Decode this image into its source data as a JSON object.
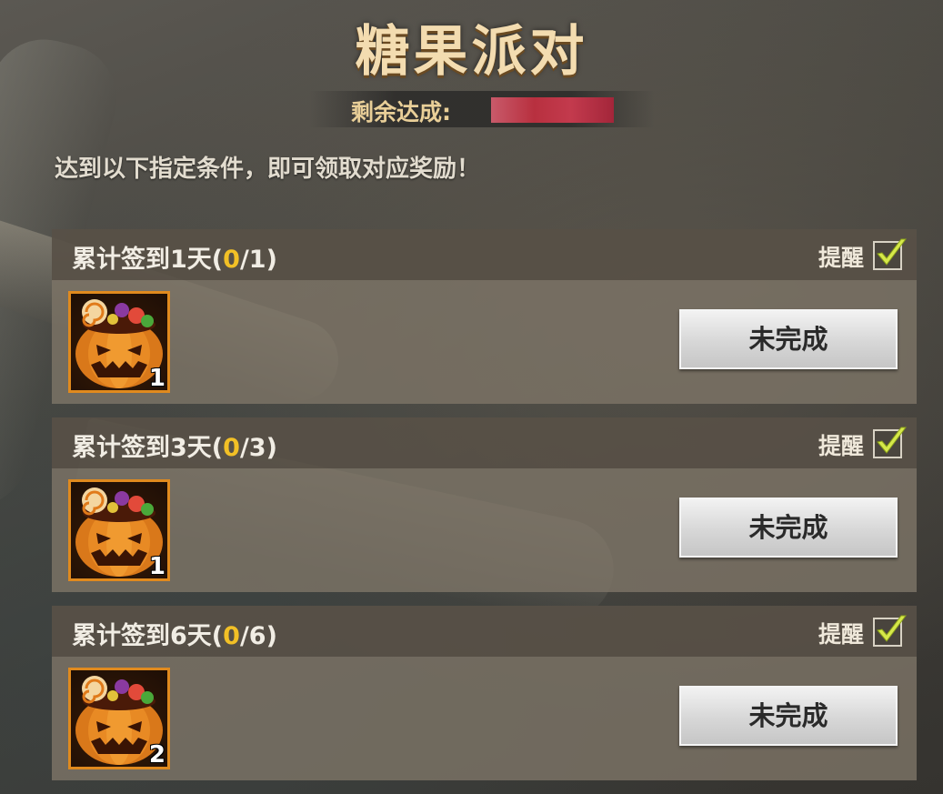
{
  "header": {
    "title": "糖果派对",
    "remain_label": "剩余达成:"
  },
  "intro_text": "达到以下指定条件，即可领取对应奖励！",
  "tasks": [
    {
      "title_prefix": "累计签到1天(",
      "progress_current": "0",
      "progress_rest": "/1)",
      "remind_label": "提醒",
      "remind_checked": true,
      "reward_icon": "candy-pumpkin-icon",
      "reward_count": "1",
      "status_label": "未完成"
    },
    {
      "title_prefix": "累计签到3天(",
      "progress_current": "0",
      "progress_rest": "/3)",
      "remind_label": "提醒",
      "remind_checked": true,
      "reward_icon": "candy-pumpkin-icon",
      "reward_count": "1",
      "status_label": "未完成"
    },
    {
      "title_prefix": "累计签到6天(",
      "progress_current": "0",
      "progress_rest": "/6)",
      "remind_label": "提醒",
      "remind_checked": true,
      "reward_icon": "candy-pumpkin-icon",
      "reward_count": "2",
      "status_label": "未完成"
    }
  ],
  "colors": {
    "title": "#f3dcb0",
    "progress_highlight": "#f2c026",
    "check": "#d6e84a"
  }
}
